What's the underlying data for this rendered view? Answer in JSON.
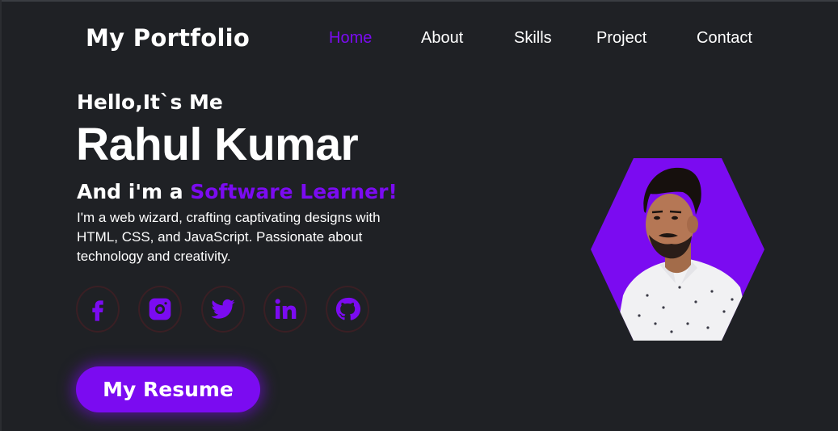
{
  "header": {
    "logo": "My Portfolio",
    "nav": [
      {
        "label": "Home",
        "active": true
      },
      {
        "label": "About",
        "active": false
      },
      {
        "label": "Skills",
        "active": false
      },
      {
        "label": "Project",
        "active": false
      },
      {
        "label": "Contact",
        "active": false
      }
    ]
  },
  "hero": {
    "greeting": "Hello,It`s Me",
    "name": "Rahul Kumar",
    "role_prefix": "And i'm a ",
    "role_highlight": "Software Learner!",
    "description": "I'm a web wizard, crafting captivating designs with HTML, CSS, and JavaScript. Passionate about technology and creativity.",
    "resume_button": "My Resume"
  },
  "socials": [
    {
      "icon": "facebook-icon"
    },
    {
      "icon": "instagram-icon"
    },
    {
      "icon": "twitter-icon"
    },
    {
      "icon": "linkedin-icon"
    },
    {
      "icon": "github-icon"
    }
  ],
  "colors": {
    "background": "#1f2125",
    "accent": "#7b0bf1",
    "text": "#ffffff"
  }
}
